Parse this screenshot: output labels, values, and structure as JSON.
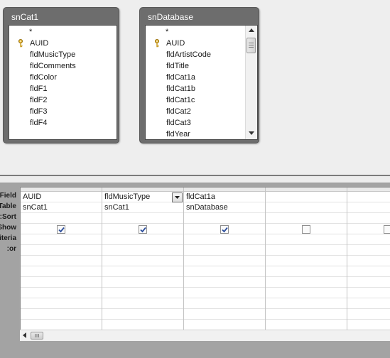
{
  "tables": [
    {
      "title": "snCat1",
      "fields": [
        "*",
        "AUID",
        "fldMusicType",
        "fldComments",
        "fldColor",
        "fldF1",
        "fldF2",
        "fldF3",
        "fldF4"
      ],
      "key_field_index": 1
    },
    {
      "title": "snDatabase",
      "fields": [
        "*",
        "AUID",
        "fldArtistCode",
        "fldTitle",
        "fldCat1a",
        "fldCat1b",
        "fldCat1c",
        "fldCat2",
        "fldCat3",
        "fldYear"
      ],
      "key_field_index": 1
    }
  ],
  "grid": {
    "row_labels": {
      "field": "Field:",
      "table": "Table:",
      "sort": "Sort:",
      "show": "Show:",
      "criteria": "Criteria:",
      "or": "or:"
    },
    "columns": [
      {
        "field": "AUID",
        "table": "snCat1",
        "show": true
      },
      {
        "field": "fldMusicType",
        "table": "snCat1",
        "show": true,
        "dropdown": true
      },
      {
        "field": "fldCat1a",
        "table": "snDatabase",
        "show": true
      },
      {
        "field": "",
        "table": "",
        "show": false
      },
      {
        "field": "",
        "table": "",
        "show": false
      }
    ]
  },
  "icons": {
    "primary_key": "key-icon",
    "checkbox_checked": "checkmark-icon",
    "dropdown": "chevron-down-icon"
  },
  "colors": {
    "table_header": "#6d6d6d",
    "grid_panel": "#a3a3a3",
    "check_color": "#2a4d9c"
  }
}
